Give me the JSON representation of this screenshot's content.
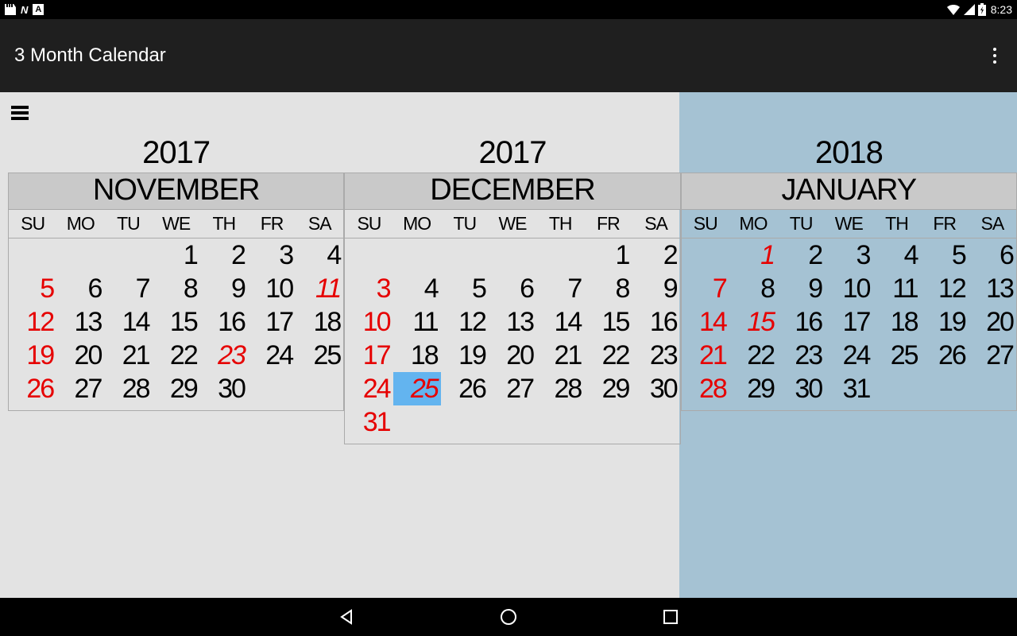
{
  "status": {
    "time": "8:23"
  },
  "app": {
    "title": "3 Month Calendar"
  },
  "dow": [
    "SU",
    "MO",
    "TU",
    "WE",
    "TH",
    "FR",
    "SA"
  ],
  "months": [
    {
      "year": "2017",
      "name": "NOVEMBER",
      "future": false,
      "days": [
        {
          "n": "",
          "t": ""
        },
        {
          "n": "",
          "t": ""
        },
        {
          "n": "",
          "t": ""
        },
        {
          "n": "1",
          "t": "n"
        },
        {
          "n": "2",
          "t": "n"
        },
        {
          "n": "3",
          "t": "n"
        },
        {
          "n": "4",
          "t": "n"
        },
        {
          "n": "5",
          "t": "r"
        },
        {
          "n": "6",
          "t": "n"
        },
        {
          "n": "7",
          "t": "n"
        },
        {
          "n": "8",
          "t": "n"
        },
        {
          "n": "9",
          "t": "n"
        },
        {
          "n": "10",
          "t": "n"
        },
        {
          "n": "11",
          "t": "rh"
        },
        {
          "n": "12",
          "t": "r"
        },
        {
          "n": "13",
          "t": "n"
        },
        {
          "n": "14",
          "t": "n"
        },
        {
          "n": "15",
          "t": "n"
        },
        {
          "n": "16",
          "t": "n"
        },
        {
          "n": "17",
          "t": "n"
        },
        {
          "n": "18",
          "t": "n"
        },
        {
          "n": "19",
          "t": "r"
        },
        {
          "n": "20",
          "t": "n"
        },
        {
          "n": "21",
          "t": "n"
        },
        {
          "n": "22",
          "t": "n"
        },
        {
          "n": "23",
          "t": "rh"
        },
        {
          "n": "24",
          "t": "n"
        },
        {
          "n": "25",
          "t": "n"
        },
        {
          "n": "26",
          "t": "r"
        },
        {
          "n": "27",
          "t": "n"
        },
        {
          "n": "28",
          "t": "n"
        },
        {
          "n": "29",
          "t": "n"
        },
        {
          "n": "30",
          "t": "n"
        },
        {
          "n": "",
          "t": ""
        },
        {
          "n": "",
          "t": ""
        }
      ]
    },
    {
      "year": "2017",
      "name": "DECEMBER",
      "future": false,
      "days": [
        {
          "n": "",
          "t": ""
        },
        {
          "n": "",
          "t": ""
        },
        {
          "n": "",
          "t": ""
        },
        {
          "n": "",
          "t": ""
        },
        {
          "n": "",
          "t": ""
        },
        {
          "n": "1",
          "t": "n"
        },
        {
          "n": "2",
          "t": "n"
        },
        {
          "n": "3",
          "t": "r"
        },
        {
          "n": "4",
          "t": "n"
        },
        {
          "n": "5",
          "t": "n"
        },
        {
          "n": "6",
          "t": "n"
        },
        {
          "n": "7",
          "t": "n"
        },
        {
          "n": "8",
          "t": "n"
        },
        {
          "n": "9",
          "t": "n"
        },
        {
          "n": "10",
          "t": "r"
        },
        {
          "n": "11",
          "t": "n"
        },
        {
          "n": "12",
          "t": "n"
        },
        {
          "n": "13",
          "t": "n"
        },
        {
          "n": "14",
          "t": "n"
        },
        {
          "n": "15",
          "t": "n"
        },
        {
          "n": "16",
          "t": "n"
        },
        {
          "n": "17",
          "t": "r"
        },
        {
          "n": "18",
          "t": "n"
        },
        {
          "n": "19",
          "t": "n"
        },
        {
          "n": "20",
          "t": "n"
        },
        {
          "n": "21",
          "t": "n"
        },
        {
          "n": "22",
          "t": "n"
        },
        {
          "n": "23",
          "t": "n"
        },
        {
          "n": "24",
          "t": "r"
        },
        {
          "n": "25",
          "t": "rht"
        },
        {
          "n": "26",
          "t": "n"
        },
        {
          "n": "27",
          "t": "n"
        },
        {
          "n": "28",
          "t": "n"
        },
        {
          "n": "29",
          "t": "n"
        },
        {
          "n": "30",
          "t": "n"
        },
        {
          "n": "31",
          "t": "r"
        },
        {
          "n": "",
          "t": ""
        },
        {
          "n": "",
          "t": ""
        },
        {
          "n": "",
          "t": ""
        },
        {
          "n": "",
          "t": ""
        },
        {
          "n": "",
          "t": ""
        },
        {
          "n": "",
          "t": ""
        }
      ]
    },
    {
      "year": "2018",
      "name": "JANUARY",
      "future": true,
      "days": [
        {
          "n": "",
          "t": ""
        },
        {
          "n": "1",
          "t": "rh"
        },
        {
          "n": "2",
          "t": "n"
        },
        {
          "n": "3",
          "t": "n"
        },
        {
          "n": "4",
          "t": "n"
        },
        {
          "n": "5",
          "t": "n"
        },
        {
          "n": "6",
          "t": "n"
        },
        {
          "n": "7",
          "t": "r"
        },
        {
          "n": "8",
          "t": "n"
        },
        {
          "n": "9",
          "t": "n"
        },
        {
          "n": "10",
          "t": "n"
        },
        {
          "n": "11",
          "t": "n"
        },
        {
          "n": "12",
          "t": "n"
        },
        {
          "n": "13",
          "t": "n"
        },
        {
          "n": "14",
          "t": "r"
        },
        {
          "n": "15",
          "t": "rh"
        },
        {
          "n": "16",
          "t": "n"
        },
        {
          "n": "17",
          "t": "n"
        },
        {
          "n": "18",
          "t": "n"
        },
        {
          "n": "19",
          "t": "n"
        },
        {
          "n": "20",
          "t": "n"
        },
        {
          "n": "21",
          "t": "r"
        },
        {
          "n": "22",
          "t": "n"
        },
        {
          "n": "23",
          "t": "n"
        },
        {
          "n": "24",
          "t": "n"
        },
        {
          "n": "25",
          "t": "n"
        },
        {
          "n": "26",
          "t": "n"
        },
        {
          "n": "27",
          "t": "n"
        },
        {
          "n": "28",
          "t": "r"
        },
        {
          "n": "29",
          "t": "n"
        },
        {
          "n": "30",
          "t": "n"
        },
        {
          "n": "31",
          "t": "n"
        },
        {
          "n": "",
          "t": ""
        },
        {
          "n": "",
          "t": ""
        },
        {
          "n": "",
          "t": ""
        }
      ]
    }
  ]
}
